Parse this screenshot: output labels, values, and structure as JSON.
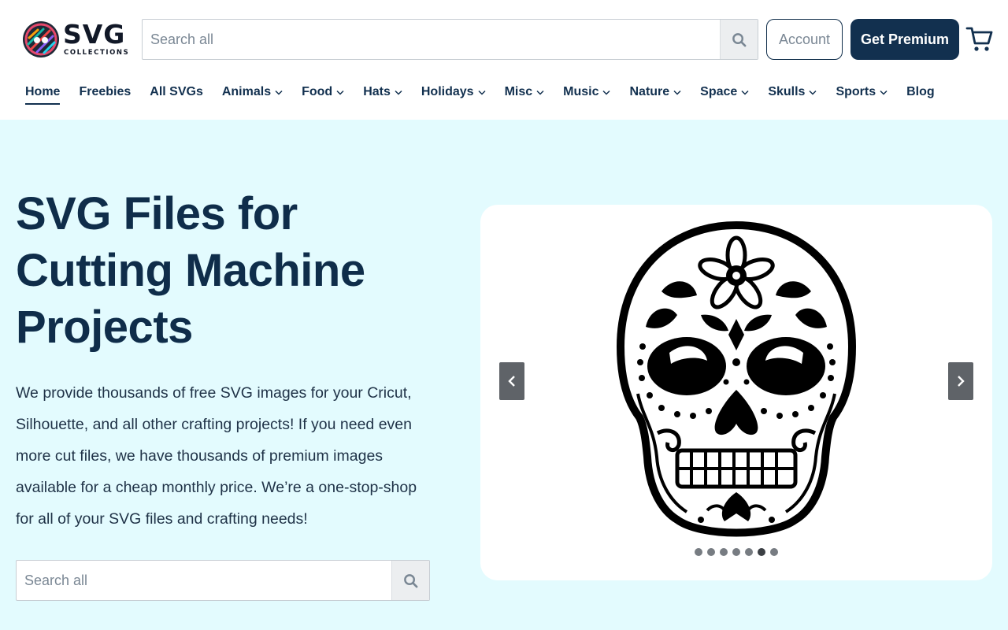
{
  "header": {
    "logo": {
      "main": "SVG",
      "sub": "COLLECTIONS"
    },
    "search": {
      "placeholder": "Search all"
    },
    "account_label": "Account",
    "premium_label": "Get Premium",
    "nav": [
      {
        "label": "Home",
        "active": true,
        "dropdown": false
      },
      {
        "label": "Freebies",
        "dropdown": false
      },
      {
        "label": "All SVGs",
        "dropdown": false
      },
      {
        "label": "Animals",
        "dropdown": true
      },
      {
        "label": "Food",
        "dropdown": true
      },
      {
        "label": "Hats",
        "dropdown": true
      },
      {
        "label": "Holidays",
        "dropdown": true
      },
      {
        "label": "Misc",
        "dropdown": true
      },
      {
        "label": "Music",
        "dropdown": true
      },
      {
        "label": "Nature",
        "dropdown": true
      },
      {
        "label": "Space",
        "dropdown": true
      },
      {
        "label": "Skulls",
        "dropdown": true
      },
      {
        "label": "Sports",
        "dropdown": true
      },
      {
        "label": "Blog",
        "dropdown": false
      }
    ]
  },
  "hero": {
    "title": "SVG Files for Cutting Machine Projects",
    "description": "We provide thousands of free SVG images for your Cricut, Silhouette, and all other crafting projects! If you need even more cut files, we have thousands of premium images available for a cheap monthly price. We’re a one-stop-shop for all of your SVG files and crafting needs!",
    "search": {
      "placeholder": "Search all"
    }
  },
  "carousel": {
    "image_icon": "sugar-skull-icon",
    "dot_count": 7,
    "active_dot": 6
  },
  "colors": {
    "navy": "#12304f",
    "hero_bg": "#e3fbfe",
    "premium_bg": "#12304f"
  },
  "icons": {
    "search": "search-icon",
    "cart": "cart-icon",
    "chevron": "chevron-down-icon",
    "prev": "chevron-left-icon",
    "next": "chevron-right-icon"
  }
}
